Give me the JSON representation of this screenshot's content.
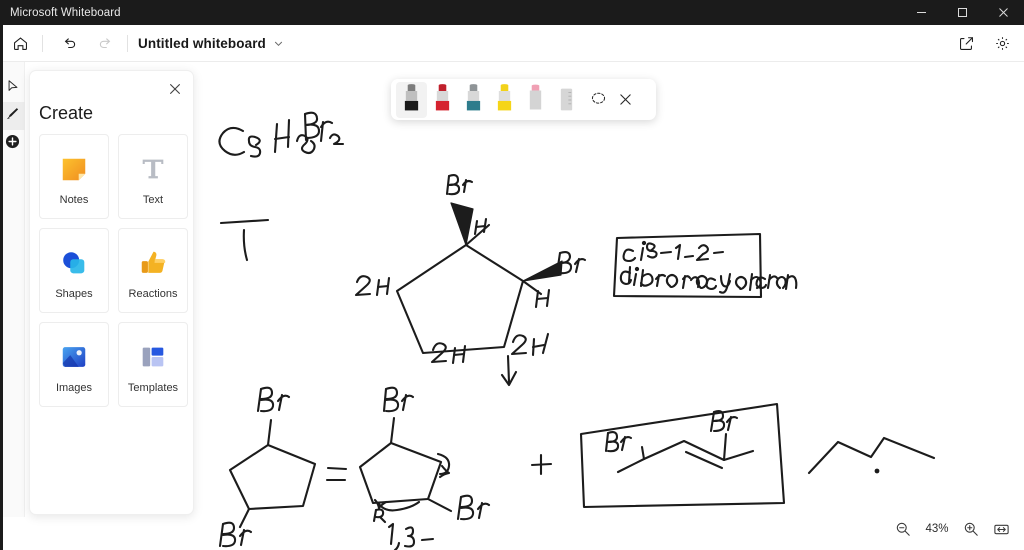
{
  "window": {
    "app_title": "Microsoft Whiteboard",
    "controls": [
      {
        "name": "minimize",
        "glyph": "minimize-icon"
      },
      {
        "name": "maximize",
        "glyph": "maximize-icon"
      },
      {
        "name": "close",
        "glyph": "close-icon"
      }
    ]
  },
  "toolbar": {
    "home_icon": "home-icon",
    "undo_icon": "undo-icon",
    "redo_icon": "redo-icon",
    "title": "Untitled whiteboard",
    "title_chevron": "chevron-down-icon",
    "share_icon": "share-icon",
    "settings_icon": "gear-icon"
  },
  "rail": {
    "items": [
      {
        "name": "select-tool",
        "icon": "cursor-icon",
        "active": false
      },
      {
        "name": "pen-tool",
        "icon": "pen-icon",
        "active": true
      },
      {
        "name": "add-tool",
        "icon": "plus-circle-icon",
        "active": false
      }
    ]
  },
  "panel": {
    "title": "Create",
    "close_icon": "close-icon",
    "cards": [
      {
        "label": "Notes",
        "icon": "sticky-note-icon"
      },
      {
        "label": "Text",
        "icon": "text-T-icon"
      },
      {
        "label": "Shapes",
        "icon": "shapes-icon"
      },
      {
        "label": "Reactions",
        "icon": "thumbs-up-icon"
      },
      {
        "label": "Images",
        "icon": "image-icon"
      },
      {
        "label": "Templates",
        "icon": "templates-icon"
      }
    ]
  },
  "pen_toolbar": {
    "pens": [
      {
        "name": "black-pen",
        "color": "#1a1a1a",
        "selected": true
      },
      {
        "name": "red-pen",
        "color": "#d5232f",
        "selected": false
      },
      {
        "name": "teal-pen",
        "color": "#2e7c8c",
        "selected": false
      },
      {
        "name": "yellow-highlighter",
        "color": "#f5d518",
        "selected": false
      },
      {
        "name": "eraser",
        "color": "#f0a0b4",
        "selected": false
      },
      {
        "name": "ruler",
        "color": "#c9c9c9",
        "selected": false
      }
    ],
    "lasso_icon": "lasso-select-icon",
    "close_icon": "close-icon"
  },
  "zoom": {
    "zoom_out_icon": "zoom-out-icon",
    "percent": "43%",
    "zoom_in_icon": "zoom-in-icon",
    "fit_icon": "fit-to-screen-icon"
  },
  "ink": {
    "formula": "C5H8Br2",
    "formula_parts": {
      "c": "C",
      "c_sub": "5",
      "h": "H",
      "h_sub": "8",
      "br": "Br",
      "br_sub": "2"
    },
    "top_structure": {
      "label_br_top": "Br",
      "label_h_top": "H",
      "label_br_right": "Br",
      "label_h_right": "H",
      "label_2h_left": "2H",
      "label_2h_bottom": "2H",
      "label_2h_right": "2H"
    },
    "callout": {
      "line1": "cis-1,2-",
      "line2": "dibromocyclopentane"
    },
    "bottom_left_structure": {
      "label_br_top": "Br",
      "label_br_bottom": "Br"
    },
    "equals_sign": "=",
    "bottom_mid_structure": {
      "label_br_top": "Br",
      "label_br_right": "Br",
      "label_r_right": "R",
      "label_r_bottom": "R",
      "label_position": "1,3-"
    },
    "plus_sign": "+",
    "boxed_alkene": {
      "label_br_left": "Br",
      "label_br_right": "Br"
    }
  }
}
